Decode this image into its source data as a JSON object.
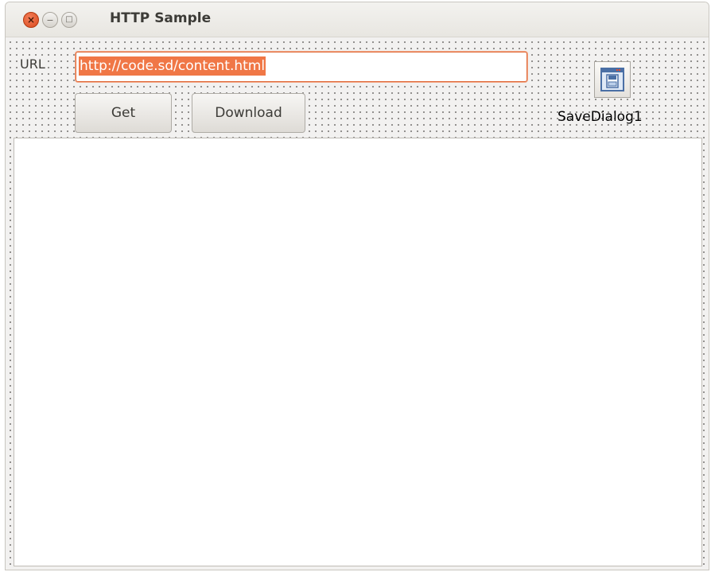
{
  "window": {
    "title": "HTTP Sample",
    "controls": {
      "close_glyph": "×",
      "minimize_glyph": "−",
      "maximize_glyph": "□"
    }
  },
  "form": {
    "url_label": "URL",
    "url_value": "http://code.sd/content.html",
    "get_button": "Get",
    "download_button": "Download",
    "component_label": "SaveDialog1",
    "component_icon": "save-dialog-icon"
  },
  "colors": {
    "selection": "#f07746",
    "close_button": "#e05a2b",
    "window_bg": "#f2f1f0"
  }
}
